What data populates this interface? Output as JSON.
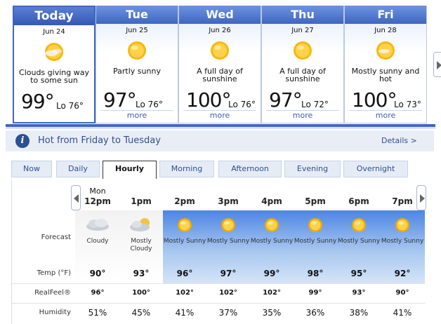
{
  "daily": [
    {
      "name": "Today",
      "date": "Jun 24",
      "desc": "Clouds giving way to some sun",
      "high": "99°",
      "lo": "Lo 76°",
      "more": "",
      "icon": "sun-cloud-icon",
      "today": true
    },
    {
      "name": "Tue",
      "date": "Jun 25",
      "desc": "Partly sunny",
      "high": "97°",
      "lo": "Lo 76°",
      "more": "more",
      "icon": "sun-icon"
    },
    {
      "name": "Wed",
      "date": "Jun 26",
      "desc": "A full day of sunshine",
      "high": "100°",
      "lo": "Lo 76°",
      "more": "more",
      "icon": "sun-icon"
    },
    {
      "name": "Thu",
      "date": "Jun 27",
      "desc": "A full day of sunshine",
      "high": "97°",
      "lo": "Lo 72°",
      "more": "more",
      "icon": "sun-icon"
    },
    {
      "name": "Fri",
      "date": "Jun 28",
      "desc": "Mostly sunny and hot",
      "high": "100°",
      "lo": "Lo 73°",
      "more": "more",
      "icon": "sun-cloud-icon"
    }
  ],
  "alert": {
    "text": "Hot from Friday to Tuesday",
    "details": "Details >"
  },
  "tabs": [
    "Now",
    "Daily",
    "Hourly",
    "Morning",
    "Afternoon",
    "Evening",
    "Overnight"
  ],
  "active_tab": "Hourly",
  "hourly": {
    "labels": {
      "forecast": "Forecast",
      "temp": "Temp (°F)",
      "realfeel": "RealFeel®",
      "humidity": "Humidity"
    },
    "day_label": "Mon",
    "hours": [
      {
        "time": "12pm",
        "cond": "Cloudy",
        "temp": "90°",
        "realfeel": "96°",
        "humidity": "51%",
        "icon": "cloud-icon"
      },
      {
        "time": "1pm",
        "cond": "Mostly Cloudy",
        "temp": "93°",
        "realfeel": "100°",
        "humidity": "45%",
        "icon": "cloud-sun-icon"
      },
      {
        "time": "2pm",
        "cond": "Mostly Sunny",
        "temp": "96°",
        "realfeel": "102°",
        "humidity": "41%",
        "icon": "sun-icon"
      },
      {
        "time": "3pm",
        "cond": "Mostly Sunny",
        "temp": "97°",
        "realfeel": "102°",
        "humidity": "37%",
        "icon": "sun-icon"
      },
      {
        "time": "4pm",
        "cond": "Mostly Sunny",
        "temp": "99°",
        "realfeel": "102°",
        "humidity": "35%",
        "icon": "sun-icon"
      },
      {
        "time": "5pm",
        "cond": "Mostly Sunny",
        "temp": "98°",
        "realfeel": "99°",
        "humidity": "36%",
        "icon": "sun-icon"
      },
      {
        "time": "6pm",
        "cond": "Mostly Sunny",
        "temp": "95°",
        "realfeel": "93°",
        "humidity": "38%",
        "icon": "sun-icon"
      },
      {
        "time": "7pm",
        "cond": "Mostly Sunny",
        "temp": "92°",
        "realfeel": "90°",
        "humidity": "41%",
        "icon": "sun-icon"
      }
    ]
  },
  "colors": {
    "accent": "#3f66c0",
    "link": "#2e4f8f",
    "sun": "#f7b80f"
  }
}
